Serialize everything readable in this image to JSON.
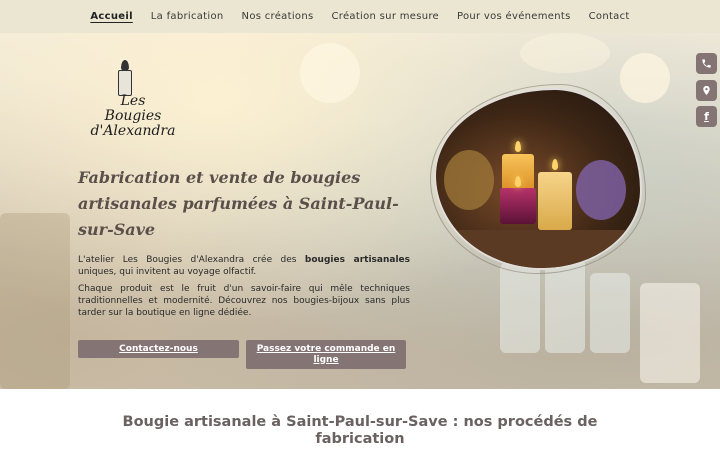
{
  "nav": {
    "items": [
      {
        "label": "Accueil",
        "active": true
      },
      {
        "label": "La fabrication",
        "active": false
      },
      {
        "label": "Nos créations",
        "active": false
      },
      {
        "label": "Création sur mesure",
        "active": false
      },
      {
        "label": "Pour vos événements",
        "active": false
      },
      {
        "label": "Contact",
        "active": false
      }
    ]
  },
  "logo": {
    "line1": "Les",
    "line2": "Bougies",
    "line3": "d'Alexandra"
  },
  "hero": {
    "headline": "Fabrication et vente de bougies artisanales parfumées à Saint-Paul-sur-Save",
    "p1_before": "L'atelier Les Bougies d'Alexandra crée des ",
    "p1_strong": "bougies artisanales",
    "p1_after": " uniques, qui invitent au voyage olfactif.",
    "p2": "Chaque produit est le fruit d'un savoir-faire qui mêle techniques traditionnelles et modernité. Découvrez nos bougies-bijoux sans plus tarder sur la boutique en ligne dédiée.",
    "btn_contact": "Contactez-nous",
    "btn_order": "Passez votre commande en ligne"
  },
  "social": {
    "phone_icon": "phone-icon",
    "pin_icon": "map-pin-icon",
    "facebook_icon": "facebook-icon",
    "facebook_glyph": "f"
  },
  "section": {
    "title": "Bougie artisanale à Saint-Paul-sur-Save : nos procédés de fabrication"
  },
  "colors": {
    "nav_bg": "#ebe6d1",
    "button_bg": "#857474",
    "headline_color": "#5a4f4a",
    "section_title_color": "#6a6161"
  }
}
